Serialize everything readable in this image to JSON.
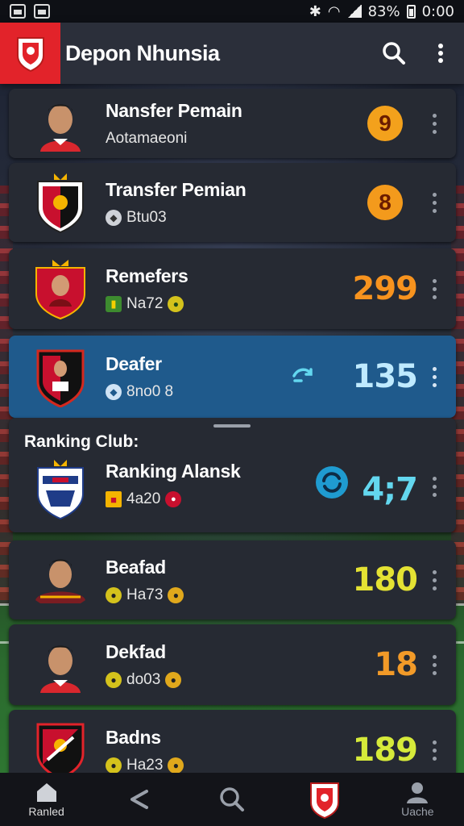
{
  "status_bar": {
    "battery": "83%",
    "time": "0:00"
  },
  "app_bar": {
    "title": "Depon Nhunsia"
  },
  "items": [
    {
      "name": "Nansfer Pemain",
      "sub": "Aotamaeoni",
      "score": "9",
      "score_style": "badge",
      "score_color": "#f3a11c"
    },
    {
      "name": "Transfer Pemian",
      "sub": "Btu03",
      "score": "8",
      "score_style": "badge",
      "score_color": "#f39a1c"
    },
    {
      "name": "Remefers",
      "sub": "Na72",
      "score": "299",
      "score_style": "text",
      "score_color": "#f7931e"
    },
    {
      "name": "Deafer",
      "sub": "8no0 8",
      "score": "135",
      "score_style": "text",
      "score_color": "#bfeaff"
    },
    {
      "name": "Ranking Alansk",
      "sub": "4a20",
      "score": "4;7",
      "score_style": "text",
      "score_color": "#63d7ef"
    },
    {
      "name": "Beafad",
      "sub": "Ha73",
      "score": "180",
      "score_style": "text",
      "score_color": "#e4e233"
    },
    {
      "name": "Dekfad",
      "sub": "do03",
      "score": "18",
      "score_style": "text",
      "score_color": "#f29a28"
    },
    {
      "name": "Badns",
      "sub": "Ha23",
      "score": "189",
      "score_style": "text",
      "score_color": "#d6ea3a"
    }
  ],
  "section_label": "Ranking Club:",
  "bottom_nav": [
    {
      "label": "Ranled",
      "icon": "home-icon"
    },
    {
      "label": "",
      "icon": "share-icon"
    },
    {
      "label": "",
      "icon": "search-icon"
    },
    {
      "label": "",
      "icon": "club-crest-icon"
    },
    {
      "label": "Uache",
      "icon": "profile-icon"
    }
  ],
  "colors": {
    "accent_red": "#e2232a",
    "highlight_blue": "#1f5a8c",
    "card_bg": "#262a33"
  }
}
